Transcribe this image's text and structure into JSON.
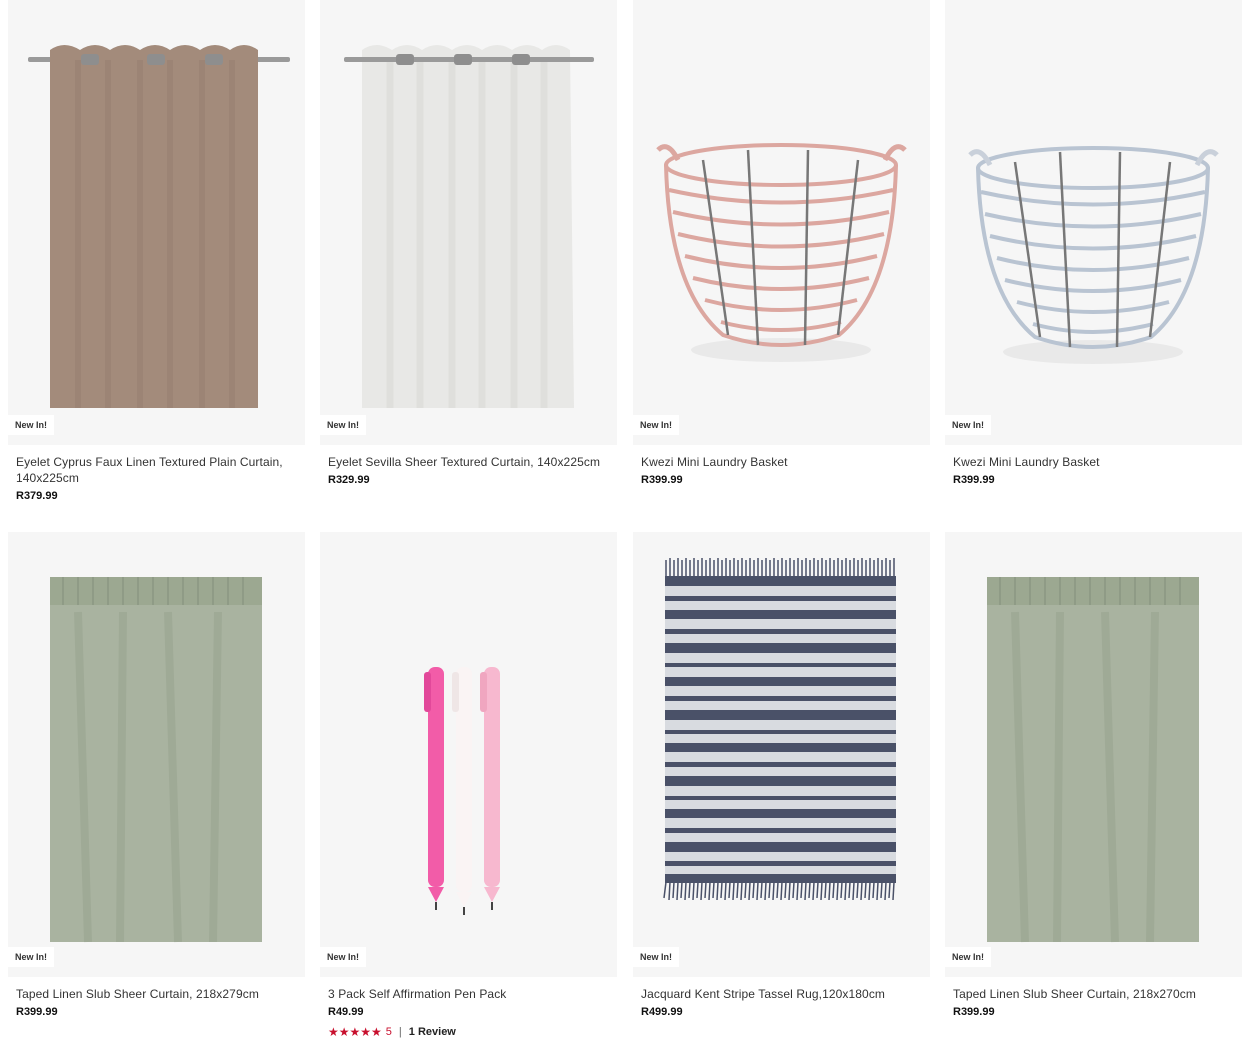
{
  "products": [
    {
      "badge": "New In!",
      "title": "Eyelet Cyprus Faux Linen Textured Plain Curtain, 140x225cm",
      "price": "R379.99",
      "image": "taupe-eyelet-curtain"
    },
    {
      "badge": "New In!",
      "title": "Eyelet Sevilla Sheer Textured Curtain, 140x225cm",
      "price": "R329.99",
      "image": "white-sheer-eyelet-curtain"
    },
    {
      "badge": "New In!",
      "title": "Kwezi Mini Laundry Basket",
      "price": "R399.99",
      "image": "pink-wire-basket"
    },
    {
      "badge": "New In!",
      "title": "Kwezi Mini Laundry Basket",
      "price": "R399.99",
      "image": "blue-wire-basket"
    },
    {
      "badge": "New In!",
      "title": "Taped Linen Slub Sheer Curtain, 218x279cm",
      "price": "R399.99",
      "image": "sage-taped-curtain"
    },
    {
      "badge": "New In!",
      "title": "3 Pack Self Affirmation Pen Pack",
      "price": "R49.99",
      "image": "pink-pens",
      "rating": {
        "stars": "★★★★★",
        "value": "5",
        "separator": "|",
        "reviews": "1 Review"
      }
    },
    {
      "badge": "New In!",
      "title": "Jacquard Kent Stripe Tassel Rug,120x180cm",
      "price": "R499.99",
      "image": "striped-rug"
    },
    {
      "badge": "New In!",
      "title": "Taped Linen Slub Sheer Curtain, 218x270cm",
      "price": "R399.99",
      "image": "sage-taped-curtain"
    }
  ],
  "colors": {
    "rating": "#c8102e",
    "card_bg": "#f6f6f6"
  }
}
